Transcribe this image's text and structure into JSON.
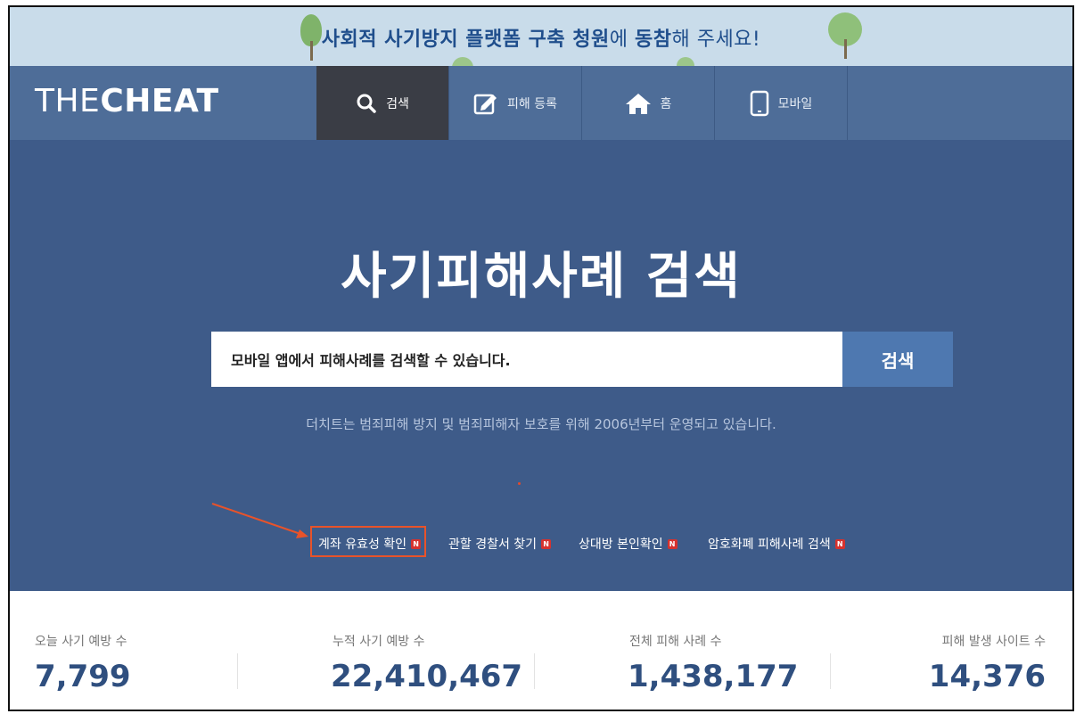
{
  "banner": {
    "part1": "사회적 사기방지 플랫폼 구축 청원",
    "part2": "에 ",
    "part3": "동참",
    "part4": "해 주세요!"
  },
  "logo": {
    "light": "THE",
    "bold": "CHEAT"
  },
  "nav": [
    {
      "label": "검색",
      "icon": "search-icon"
    },
    {
      "label": "피해 등록",
      "icon": "edit-icon"
    },
    {
      "label": "홈",
      "icon": "home-icon"
    },
    {
      "label": "모바일",
      "icon": "mobile-icon"
    }
  ],
  "hero": {
    "title": "사기피해사례 검색",
    "search_value": "모바일 앱에서 피해사례를 검색할 수 있습니다.",
    "search_button": "검색",
    "tagline": "더치트는 범죄피해 방지 및 범죄피해자 보호를 위해 2006년부터 운영되고 있습니다."
  },
  "quick_links": [
    {
      "label": "계좌 유효성 확인",
      "badge": "N"
    },
    {
      "label": "관할 경찰서 찾기",
      "badge": "N"
    },
    {
      "label": "상대방 본인확인",
      "badge": "N"
    },
    {
      "label": "암호화폐 피해사례 검색",
      "badge": "N"
    }
  ],
  "stats": [
    {
      "label": "오늘 사기 예방 수",
      "value": "7,799"
    },
    {
      "label": "누적 사기 예방 수",
      "value": "22,410,467"
    },
    {
      "label": "전체 피해 사례 수",
      "value": "1,438,177"
    },
    {
      "label": "피해 발생 사이트 수",
      "value": "14,376"
    }
  ],
  "colors": {
    "banner_bg": "#c9dcea",
    "nav_bg": "#4e6d98",
    "hero_bg": "#3e5b89",
    "search_button": "#4e78b0",
    "stat_value": "#2f4f7f",
    "highlight": "#e8532a"
  }
}
